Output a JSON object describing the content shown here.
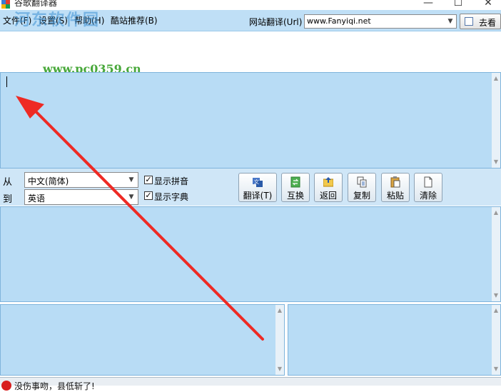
{
  "window": {
    "title": "谷歌翻译器",
    "controls": {
      "minimize": "—",
      "maximize": "☐",
      "close": "✕"
    }
  },
  "menu": {
    "items": [
      {
        "id": "file",
        "label": "文件(F)"
      },
      {
        "id": "settings",
        "label": "设置(S)"
      },
      {
        "id": "help",
        "label": "帮助(H)"
      },
      {
        "id": "recommend",
        "label": "酷站推荐(B)"
      }
    ],
    "url_label": "网站翻译(Url)",
    "url_value": "www.Fanyiqi.net",
    "goto_label": "去看"
  },
  "watermark": {
    "logo_text": "河东软件园",
    "url": "www.pc0359.cn"
  },
  "source_text": {
    "value": ""
  },
  "controls": {
    "from_label": "从",
    "to_label": "到",
    "from_value": "中文(简体)",
    "to_value": "英语",
    "show_pinyin_label": "显示拼音",
    "show_pinyin_checked": true,
    "show_dict_label": "显示字典",
    "show_dict_checked": true
  },
  "toolbar": {
    "buttons": [
      {
        "id": "translate",
        "label": "翻译(T)",
        "icon": "translate-icon"
      },
      {
        "id": "swap",
        "label": "互换",
        "icon": "swap-icon"
      },
      {
        "id": "back",
        "label": "返回",
        "icon": "back-icon"
      },
      {
        "id": "copy",
        "label": "复制",
        "icon": "copy-icon"
      },
      {
        "id": "paste",
        "label": "粘贴",
        "icon": "paste-icon"
      },
      {
        "id": "clear",
        "label": "清除",
        "icon": "clear-icon"
      }
    ]
  },
  "status": {
    "text": "没伤事吻，县低斩了!",
    "icon": "error-icon",
    "color": "#d81e1e"
  },
  "annotation": {
    "color": "#ee2a24"
  }
}
